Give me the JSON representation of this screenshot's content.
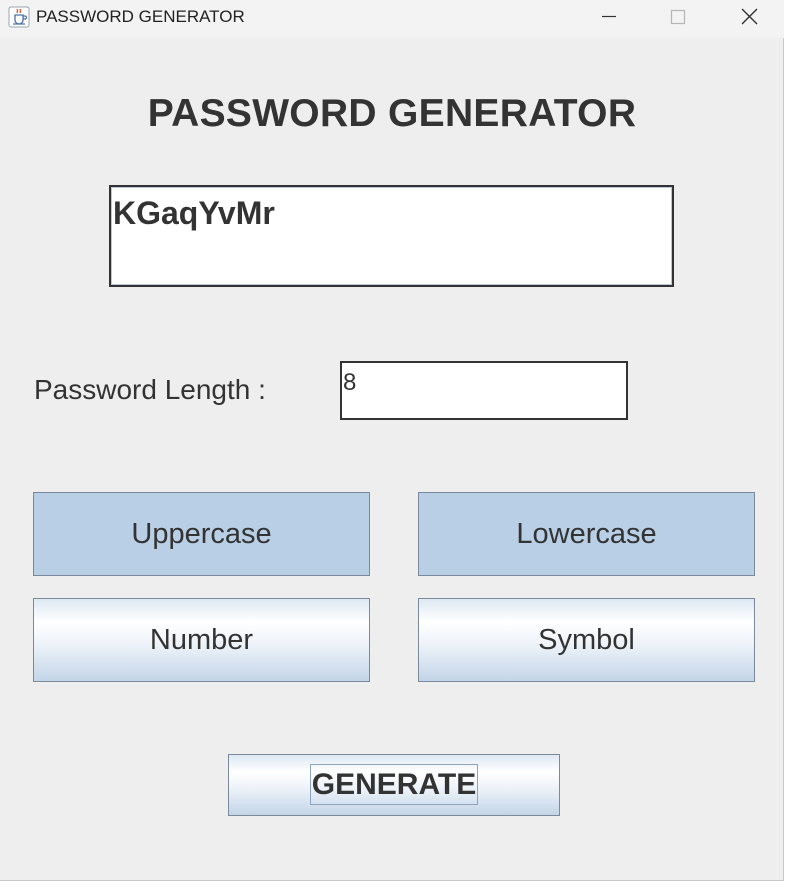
{
  "window": {
    "title": "PASSWORD GENERATOR",
    "app_icon": "java-cup-icon",
    "controls": [
      "minimize-icon",
      "maximize-icon",
      "close-icon"
    ]
  },
  "main": {
    "heading": "PASSWORD GENERATOR",
    "generated_password": "KGaqYvMr",
    "length_label": "Password Length :",
    "length_value": "8",
    "options": {
      "uppercase": "Uppercase",
      "lowercase": "Lowercase",
      "number": "Number",
      "symbol": "Symbol"
    },
    "selected_options": [
      "Uppercase",
      "Lowercase"
    ],
    "generate_label": "GENERATE"
  },
  "colors": {
    "background": "#eeeeee",
    "text": "#333333",
    "selected_button": "#b8cfe5",
    "border": "#7a8a9c"
  }
}
